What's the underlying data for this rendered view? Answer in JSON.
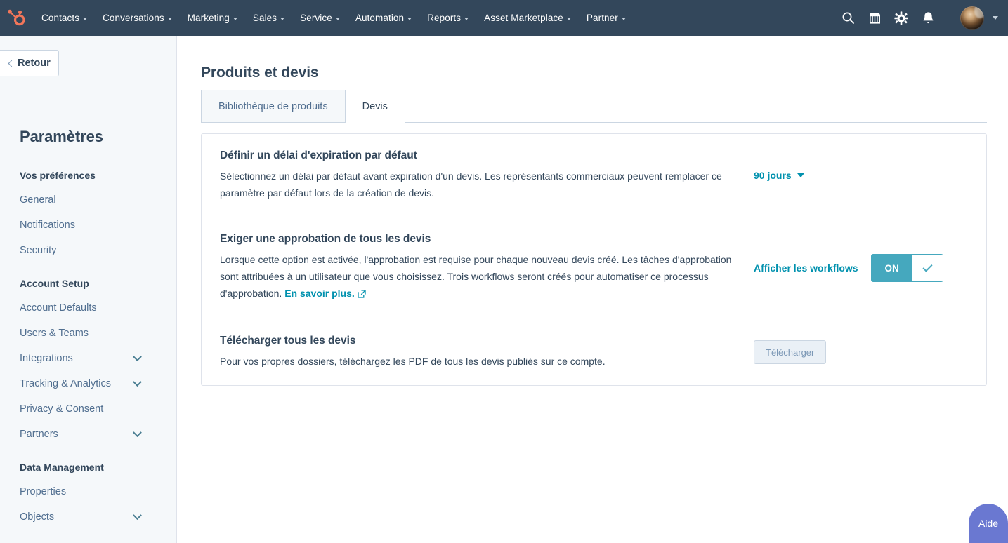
{
  "topnav": {
    "logo": "hubspot-sprocket-logo",
    "items": [
      {
        "label": "Contacts",
        "has_caret": true
      },
      {
        "label": "Conversations",
        "has_caret": true
      },
      {
        "label": "Marketing",
        "has_caret": true
      },
      {
        "label": "Sales",
        "has_caret": true
      },
      {
        "label": "Service",
        "has_caret": true
      },
      {
        "label": "Automation",
        "has_caret": true
      },
      {
        "label": "Reports",
        "has_caret": true
      },
      {
        "label": "Asset Marketplace",
        "has_caret": true
      },
      {
        "label": "Partner",
        "has_caret": true
      }
    ],
    "icons": [
      "search-icon",
      "marketplace-icon",
      "settings-gear-icon",
      "notifications-bell-icon"
    ],
    "background_color": "#33475b",
    "logo_color": "#f2765a"
  },
  "sidebar": {
    "back_button": "Retour",
    "title": "Paramètres",
    "groups": [
      {
        "label": "Vos préférences",
        "items": [
          {
            "label": "General",
            "expandable": false
          },
          {
            "label": "Notifications",
            "expandable": false
          },
          {
            "label": "Security",
            "expandable": false
          }
        ]
      },
      {
        "label": "Account Setup",
        "items": [
          {
            "label": "Account Defaults",
            "expandable": false
          },
          {
            "label": "Users & Teams",
            "expandable": false
          },
          {
            "label": "Integrations",
            "expandable": true
          },
          {
            "label": "Tracking & Analytics",
            "expandable": true
          },
          {
            "label": "Privacy & Consent",
            "expandable": false
          },
          {
            "label": "Partners",
            "expandable": true
          }
        ]
      },
      {
        "label": "Data Management",
        "items": [
          {
            "label": "Properties",
            "expandable": false
          },
          {
            "label": "Objects",
            "expandable": true
          }
        ]
      }
    ],
    "background_color": "#f5f8fa"
  },
  "main": {
    "page_title": "Produits et devis",
    "tabs": [
      {
        "label": "Bibliothèque de produits",
        "active": false
      },
      {
        "label": "Devis",
        "active": true
      }
    ],
    "rows": [
      {
        "title": "Définir un délai d'expiration par défaut",
        "description": "Sélectionnez un délai par défaut avant expiration d'un devis. Les représentants commerciaux peuvent remplacer ce paramètre par défaut lors de la création de devis.",
        "dropdown_value": "90 jours"
      },
      {
        "title": "Exiger une approbation de tous les devis",
        "description_part1": "Lorsque cette option est activée, l'approbation est requise pour chaque nouveau devis créé. Les tâches d'approbation sont attribuées à un utilisateur que vous choisissez. Trois workflows seront créés pour automatiser ce processus d'approbation. ",
        "learn_more": "En savoir plus.",
        "workflows_link": "Afficher les workflows",
        "toggle_label": "ON",
        "toggle_state": "on"
      },
      {
        "title": "Télécharger tous les devis",
        "description": "Pour vos propres dossiers, téléchargez les PDF de tous les devis publiés sur ce compte.",
        "button_label": "Télécharger"
      }
    ],
    "link_color": "#0091ae",
    "toggle_color": "#45a8be"
  },
  "help": {
    "label": "Aide",
    "color": "#6a78d1"
  }
}
